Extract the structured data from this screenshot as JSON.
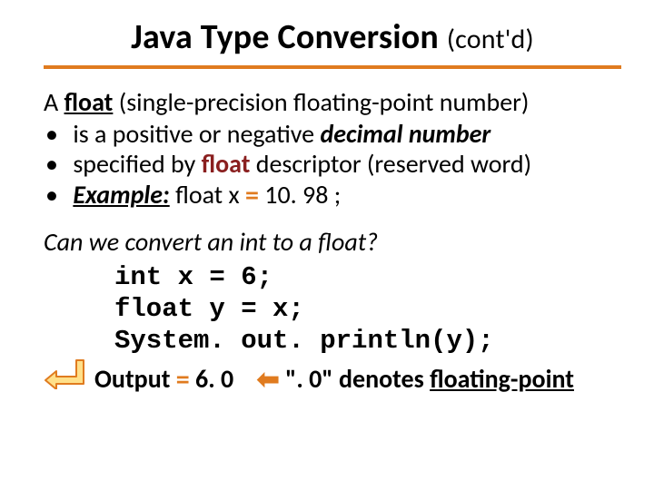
{
  "title": {
    "main": "Java Type Conversion",
    "sub": "(cont'd)"
  },
  "intro": {
    "pre": "A ",
    "kw": "float",
    "post": "  (single-precision floating-point number)"
  },
  "bullets": {
    "b1": {
      "pre": "is a positive or negative ",
      "em": "decimal number"
    },
    "b2": {
      "pre": "specified by ",
      "kw": "float",
      "post": " descriptor (reserved word)"
    },
    "b3": {
      "label": "Example:",
      "pre": "  float x ",
      "eq": "=",
      "post": " 10. 98 ;"
    }
  },
  "question": "Can we convert an int to a float?",
  "code": {
    "l1": "int x = 6;",
    "l2": "float y = x;",
    "l3": "System. out. println(y);"
  },
  "output": {
    "label_pre": "Output ",
    "eq": "=",
    "value": " 6. 0",
    "note_pre": " \". 0\" denotes ",
    "note_kw": "floating-point"
  }
}
